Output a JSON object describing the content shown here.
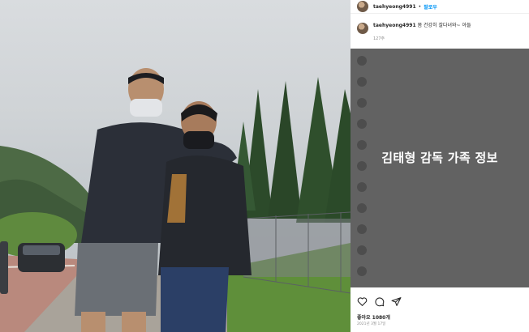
{
  "post": {
    "username": "taehyeong4991",
    "separator": "•",
    "follow_label": "팔로우",
    "caption": {
      "username": "taehyeong4991",
      "text": "몸 건강히 잘다녀와~ 아들",
      "time": "127주"
    },
    "overlay_title": "김태형 감독 가족 정보",
    "likes": "좋아요 1080개",
    "date": "2021년 3월 17일",
    "comments": [
      "",
      "",
      "",
      "",
      "",
      "",
      "",
      "",
      "",
      "",
      ""
    ]
  },
  "icons": [
    "heart-icon",
    "comment-icon",
    "share-icon"
  ],
  "colors": {
    "link": "#0095f6",
    "overlay": "#404040",
    "text": "#262626",
    "muted": "#8e8e8e"
  }
}
